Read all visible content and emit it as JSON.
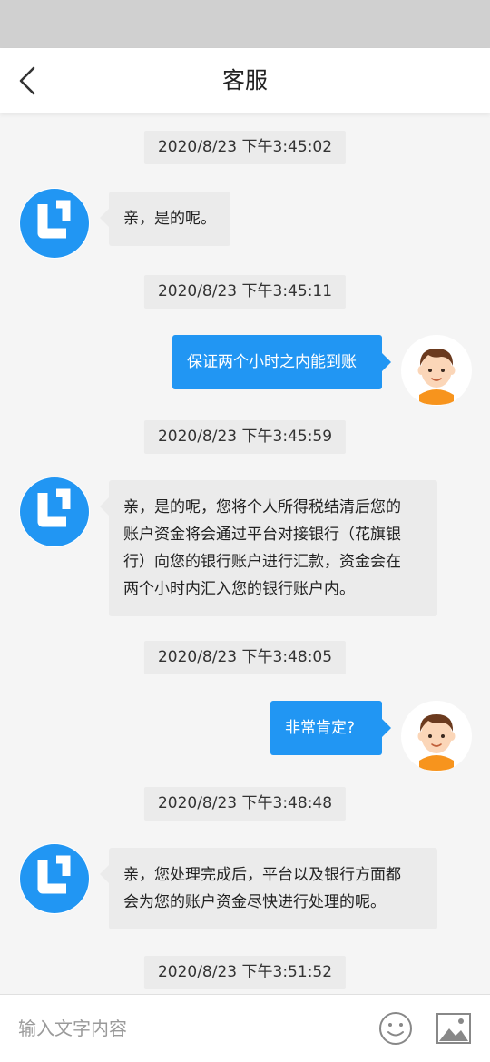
{
  "header": {
    "title": "客服",
    "back_icon": "chevron-left-icon"
  },
  "colors": {
    "accent": "#2196f3",
    "agent_bubble": "#ebebeb",
    "background": "#f5f5f5"
  },
  "messages": [
    {
      "time": "2020/8/23 下午3:45:02",
      "sender": "agent",
      "text": "亲，是的呢。"
    },
    {
      "time": "2020/8/23 下午3:45:11",
      "sender": "user",
      "text": "保证两个小时之内能到账"
    },
    {
      "time": "2020/8/23 下午3:45:59",
      "sender": "agent",
      "lines": [
        "亲，是的呢，您将个人所得税结清后您的",
        "账户资金将会通过平台对接银行（花旗银",
        "行）向您的银行账户进行汇款，资金会在",
        "两个小时内汇入您的银行账户内。"
      ]
    },
    {
      "time": "2020/8/23 下午3:48:05",
      "sender": "user",
      "text": "非常肯定?"
    },
    {
      "time": "2020/8/23 下午3:48:48",
      "sender": "agent",
      "lines": [
        "亲，您处理完成后，平台以及银行方面都",
        "会为您的账户资金尽快进行处理的呢。"
      ]
    },
    {
      "time": "2020/8/23 下午3:51:52"
    }
  ],
  "input": {
    "placeholder": "输入文字内容",
    "value": "",
    "emoji_icon": "smiley-icon",
    "image_icon": "image-icon"
  }
}
